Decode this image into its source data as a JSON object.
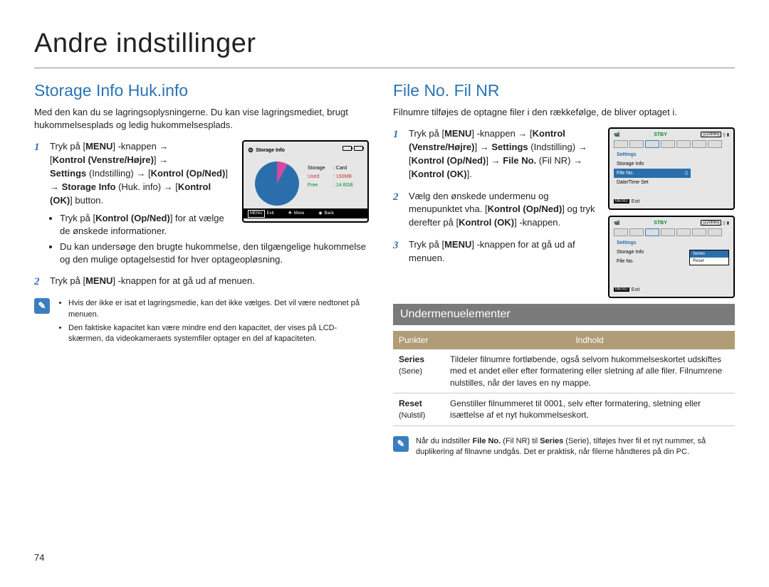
{
  "chapter_title": "Andre indstillinger",
  "page_number": "74",
  "left": {
    "heading": "Storage Info Huk.info",
    "intro": "Med den kan du se lagringsoplysningerne. Du kan vise lagringsmediet, brugt hukommelsesplads og ledig hukommelsesplads.",
    "step1_a": "Tryk på [",
    "step1_menu": "MENU",
    "step1_b": "] -knappen →",
    "step1_c": "[",
    "step1_kvh": "Kontrol (Venstre/Højre)",
    "step1_d": "] →",
    "step1_e": "Settings",
    "step1_f": " (Indstilling) → [",
    "step1_kon": "Kontrol (Op/Ned)",
    "step1_g": "] → ",
    "step1_si": "Storage Info",
    "step1_h": " (Huk. info) → [",
    "step1_kok": "Kontrol (OK)",
    "step1_i": "] button.",
    "sub1": "Tryk på [Kontrol (Op/Ned)] for at vælge de ønskede informationer.",
    "sub2": "Du kan undersøge den brugte hukommelse, den tilgængelige hukommelse og den mulige optagelsestid for hver optageopløsning.",
    "step2_a": "Tryk på [",
    "step2_menu": "MENU",
    "step2_b": "] -knappen for at gå ud af menuen.",
    "note1": "Hvis der ikke er isat et lagringsmedie, kan det ikke vælges. Det vil være nedtonet på menuen.",
    "note2": "Den faktiske kapacitet kan være mindre end den kapacitet, der vises på LCD-skærmen, da videokameraets systemfiler optager en del af kapaciteten."
  },
  "device1": {
    "title": "Storage Info",
    "lines": {
      "storage_k": "Storage",
      "storage_v": ": Card",
      "used_k": "Used",
      "used_v": ": 190MB",
      "free_k": "Free",
      "free_v": ": 14.6GB"
    },
    "footer_exit": "Exit",
    "footer_exit_btn": "MENU",
    "footer_move": "Move",
    "footer_back": "Back"
  },
  "right": {
    "heading": "File No. Fil NR",
    "intro": "Filnumre tilføjes de optagne filer i den rækkefølge, de bliver optaget i.",
    "step1_a": "Tryk på [",
    "step1_menu": "MENU",
    "step1_b": "] -knappen → [",
    "step1_c": "Kontrol (Venstre/Højre)",
    "step1_d": "] → ",
    "step1_e": "Settings",
    "step1_f": " (Indstilling) → [",
    "step1_g": "Kontrol (Op/Ned)",
    "step1_h": "] → ",
    "step1_i": "File No.",
    "step1_j": " (Fil NR) → [",
    "step1_k": "Kontrol (OK)",
    "step1_l": "].",
    "step2_a": "Vælg den ønskede undermenu og menupunktet vha. [",
    "step2_b": "Kontrol (Op/Ned)",
    "step2_c": "] og tryk derefter på [",
    "step2_d": "Kontrol (OK)",
    "step2_e": "] -knappen.",
    "step3_a": "Tryk på [",
    "step3_menu": "MENU",
    "step3_b": "] -knappen for at gå ud af menuen.",
    "subhead": "Undermenuelementer",
    "th1": "Punkter",
    "th2": "Indhold",
    "row1_k": "Series",
    "row1_k2": "(Serie)",
    "row1_v": "Tildeler filnumre fortløbende, også selvom hukommelseskortet udskiftes med et andet eller efter formatering eller sletning af alle filer. Filnumrene nulstilles, når der laves en ny mappe.",
    "row2_k": "Reset",
    "row2_k2": "(Nulstil)",
    "row2_v": "Genstiller filnummeret til 0001, selv efter formatering, sletning eller isættelse af et nyt hukommelseskort.",
    "note_a": "Når du indstiller ",
    "note_b": "File No.",
    "note_c": " (Fil NR) til ",
    "note_d": "Series",
    "note_e": " (Serie), tilføjes hver fil et nyt nummer, så duplikering af filnavne undgås. Det er praktisk, når filerne håndteres på din PC."
  },
  "device2a": {
    "stby": "STBY",
    "time": "[220Min]",
    "menu_hdr": "Settings",
    "mi1": "Storage Info",
    "mi_sel": "File No.",
    "mi3": "Date/Time Set",
    "exit_btn": "MENU",
    "exit": "Exit"
  },
  "device2b": {
    "stby": "STBY",
    "time": "[220Min]",
    "menu_hdr": "Settings",
    "mi1": "Storage Info",
    "mi2": "File No.",
    "sub_sel": "Series",
    "sub2": "Reset",
    "exit_btn": "MENU",
    "exit": "Exit"
  }
}
